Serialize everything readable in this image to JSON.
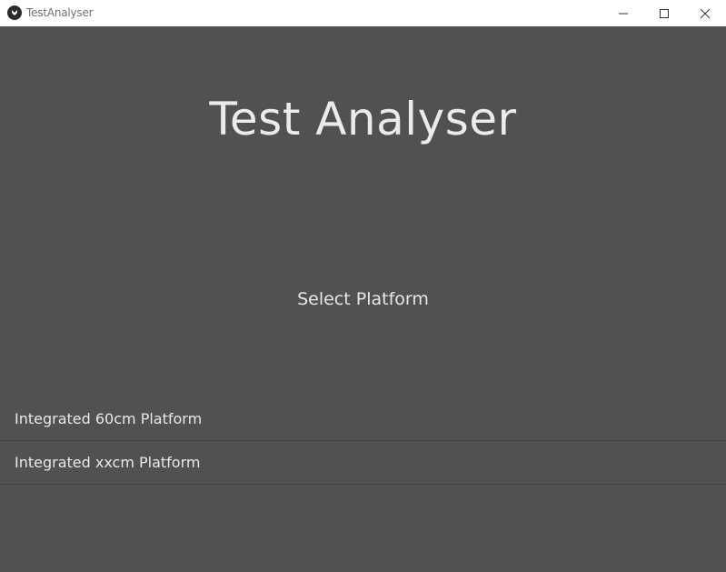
{
  "window": {
    "title": "TestAnalyser",
    "icon": "kivy-app-icon",
    "controls": [
      "minimize-icon",
      "maximize-icon",
      "close-icon"
    ]
  },
  "main": {
    "title": "Test Analyser",
    "subtitle": "Select Platform",
    "platforms": [
      {
        "label": "Integrated 60cm Platform"
      },
      {
        "label": "Integrated xxcm Platform"
      }
    ]
  },
  "colors": {
    "background": "#515151",
    "titlebar": "#ffffff",
    "text": "#ebebeb",
    "divider": "#454545"
  }
}
